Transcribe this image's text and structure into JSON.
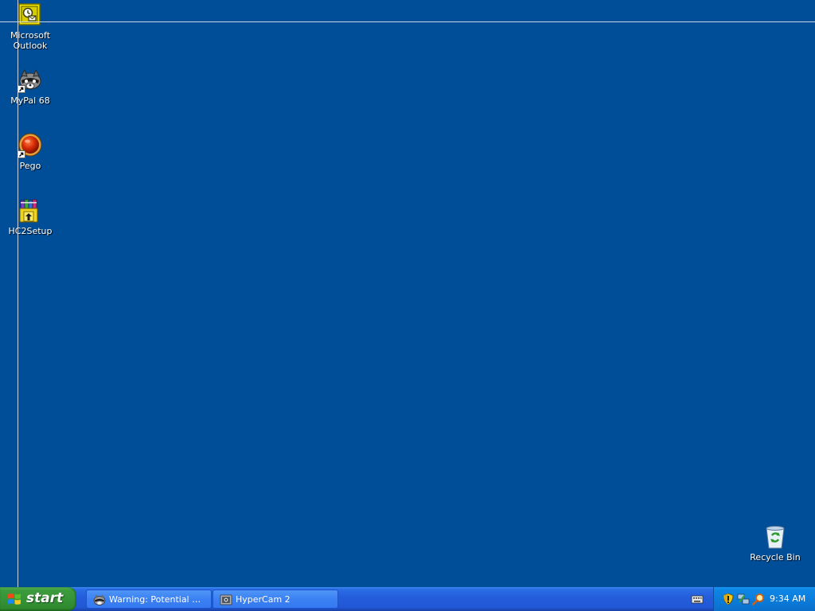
{
  "desktop": {
    "background_color": "#004e98",
    "icons": [
      {
        "label": "Microsoft Outlook",
        "icon": "outlook-icon"
      },
      {
        "label": "MyPal 68",
        "icon": "mypal-raccoon-icon",
        "shortcut": true
      },
      {
        "label": "Pego",
        "icon": "pego-red-ball-icon",
        "shortcut": true
      },
      {
        "label": "HC2Setup",
        "icon": "winrar-installer-icon"
      },
      {
        "label": "Recycle Bin",
        "icon": "recycle-bin-icon"
      }
    ]
  },
  "taskbar": {
    "start_label": "start",
    "tasks": [
      {
        "label": "Warning: Potential Se…",
        "icon": "mypal-raccoon-icon"
      },
      {
        "label": "HyperCam 2",
        "icon": "hypercam-icon"
      }
    ],
    "quick_launch": [
      {
        "icon": "keyboard-icon"
      }
    ],
    "tray": {
      "icons": [
        "security-shield-icon",
        "network-icon",
        "search-magnifier-icon"
      ],
      "clock": "9:34 AM"
    },
    "colors": {
      "bar": "#245edb",
      "start": "#379337",
      "tray": "#0b7ad9"
    }
  }
}
